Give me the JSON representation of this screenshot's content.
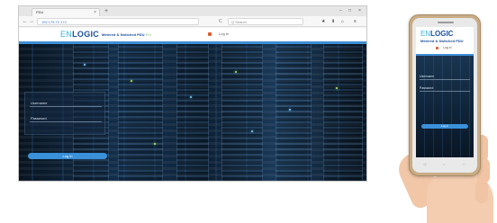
{
  "browser": {
    "tab_title": "PDU",
    "tab_close": "×",
    "new_tab": "+",
    "window_controls": [
      "–",
      "□",
      "×"
    ],
    "back": "←",
    "forward": "→",
    "url_prefix": "",
    "url_host": "192.175.72.172",
    "reload": "C",
    "search_placeholder": "Q Search",
    "toolbar_icons": [
      "★",
      "⬇",
      "⌂",
      "≡"
    ]
  },
  "desktop_page": {
    "logo_en": "EN",
    "logo_main": "LOGIC",
    "product_name": "Metered & Switched PDU",
    "product_version": "Pro",
    "login_header": "Log in",
    "username_placeholder": "Username",
    "password_placeholder": "Password",
    "login_button": "Log in"
  },
  "mobile_page": {
    "logo_en": "EN",
    "logo_main": "LOGIC",
    "product_name": "Metered & Switched PDU",
    "login_header": "Log in",
    "username_placeholder": "Username",
    "password_placeholder": "Password",
    "login_button": "Log in",
    "nav_icons": [
      "◁",
      "○",
      "□"
    ]
  },
  "colors": {
    "brand_blue": "#1a4f9c",
    "brand_light_blue": "#3bb3e6",
    "accent_bar": "#3f8fd6",
    "login_button": "#3a90d9",
    "phone_body": "#c9ad86"
  }
}
